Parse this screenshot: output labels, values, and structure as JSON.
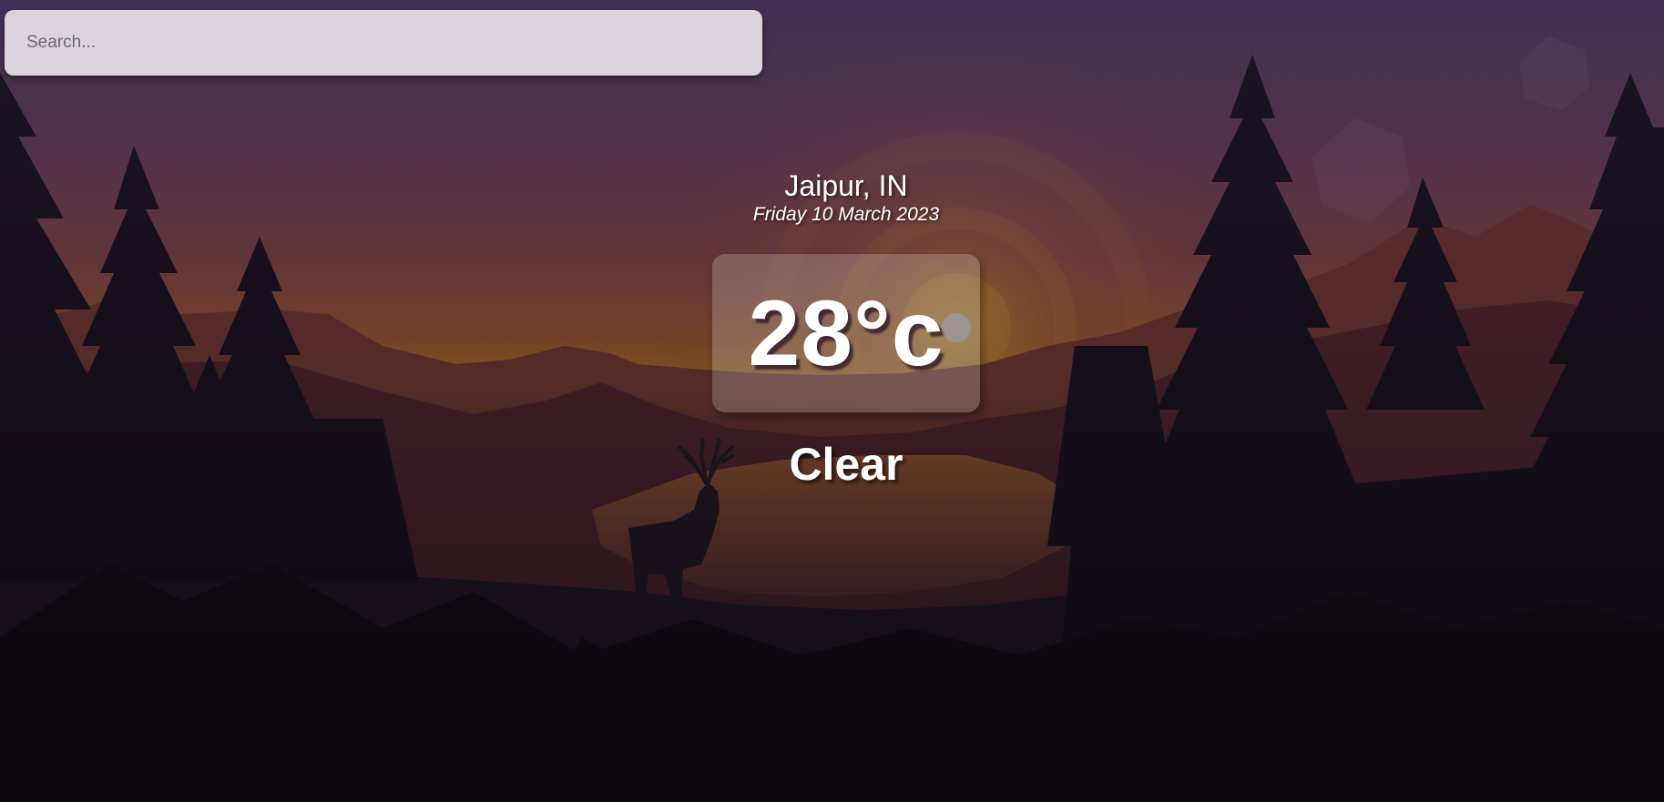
{
  "search": {
    "placeholder": "Search...",
    "value": ""
  },
  "weather": {
    "location": "Jaipur, IN",
    "date": "Friday 10 March 2023",
    "temperature": "28°c",
    "condition": "Clear"
  },
  "colors": {
    "sky_top": "#4a3a63",
    "sky_mid": "#8a4a55",
    "horizon": "#d08a2a",
    "forest": "#1e1626"
  },
  "icons": {
    "background": "sunset-forest-deer-illustration"
  }
}
